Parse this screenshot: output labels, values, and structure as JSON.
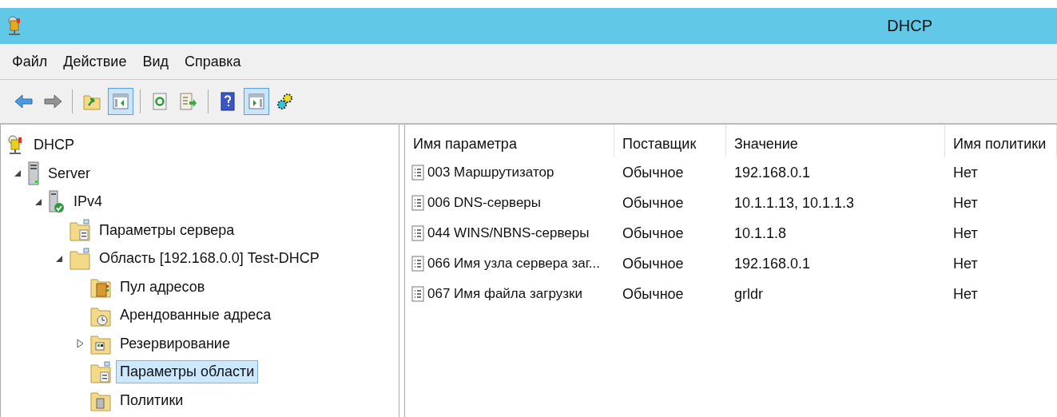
{
  "window": {
    "title": "DHCP"
  },
  "menu": [
    "Файл",
    "Действие",
    "Вид",
    "Справка"
  ],
  "toolbar": [
    {
      "kind": "back",
      "disabled": false,
      "pressed": false
    },
    {
      "kind": "forward",
      "disabled": true,
      "pressed": false
    },
    {
      "kind": "separator"
    },
    {
      "kind": "up",
      "disabled": false,
      "pressed": false
    },
    {
      "kind": "tree",
      "disabled": false,
      "pressed": true
    },
    {
      "kind": "separator"
    },
    {
      "kind": "refresh",
      "disabled": false,
      "pressed": false
    },
    {
      "kind": "export",
      "disabled": false,
      "pressed": false
    },
    {
      "kind": "separator"
    },
    {
      "kind": "help",
      "disabled": false,
      "pressed": false
    },
    {
      "kind": "action",
      "disabled": false,
      "pressed": true
    },
    {
      "kind": "gears",
      "disabled": false,
      "pressed": false
    }
  ],
  "tree": [
    {
      "label": "DHCP",
      "kind": "root",
      "selected": false,
      "children": [
        {
          "label": "Server",
          "kind": "server",
          "selected": false,
          "expanded": true,
          "children": [
            {
              "label": "IPv4",
              "kind": "protocol",
              "selected": false,
              "expanded": true,
              "children": [
                {
                  "label": "Параметры сервера",
                  "kind": "options",
                  "selected": false
                },
                {
                  "label": "Область [192.168.0.0] Test-DHCP",
                  "kind": "folder",
                  "selected": false,
                  "expanded": true,
                  "children": [
                    {
                      "label": "Пул адресов",
                      "kind": "pool",
                      "selected": false
                    },
                    {
                      "label": "Арендованные адреса",
                      "kind": "leases",
                      "selected": false
                    },
                    {
                      "label": "Резервирование",
                      "kind": "reservations",
                      "selected": false,
                      "expanded": false
                    },
                    {
                      "label": "Параметры области",
                      "kind": "options",
                      "selected": true
                    },
                    {
                      "label": "Политики",
                      "kind": "policies",
                      "selected": false
                    }
                  ]
                }
              ]
            }
          ]
        }
      ]
    }
  ],
  "table": {
    "columns": [
      "Имя параметра",
      "Поставщик",
      "Значение",
      "Имя политики"
    ],
    "rows": [
      [
        "003 Маршрутизатор",
        "Обычное",
        "192.168.0.1",
        "Нет"
      ],
      [
        "006 DNS-серверы",
        "Обычное",
        "10.1.1.13, 10.1.1.3",
        "Нет"
      ],
      [
        "044 WINS/NBNS-серверы",
        "Обычное",
        "10.1.1.8",
        "Нет"
      ],
      [
        "066 Имя узла сервера заг...",
        "Обычное",
        "192.168.0.1",
        "Нет"
      ],
      [
        "067 Имя файла загрузки",
        "Обычное",
        "grldr",
        "Нет"
      ]
    ]
  }
}
